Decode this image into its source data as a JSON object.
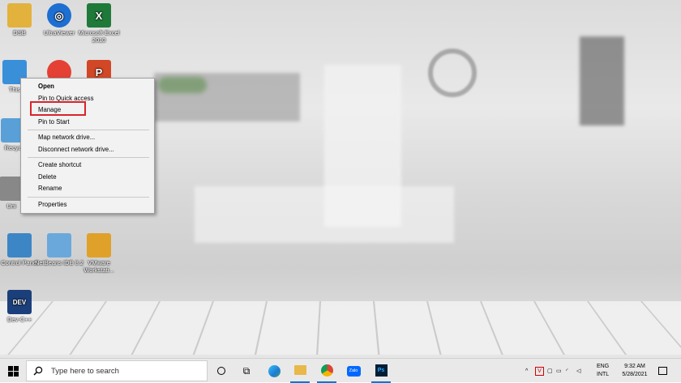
{
  "desktop": {
    "icons": [
      {
        "id": "dsb",
        "label": "DSB",
        "color": "#e3b23c"
      },
      {
        "id": "ultraviewer",
        "label": "UltraViewer",
        "color": "#1d6fd1"
      },
      {
        "id": "excel",
        "label": "Microsoft Excel 2010",
        "color": "#1f7a3a"
      },
      {
        "id": "this-pc",
        "label": "This",
        "color": "#3a8fd9"
      },
      {
        "id": "chrome",
        "label": "",
        "color": "#e44134"
      },
      {
        "id": "powerpoint",
        "label": "",
        "color": "#d24726"
      },
      {
        "id": "recycle",
        "label": "Recyc",
        "color": "#5aa0d8"
      },
      {
        "id": "uni",
        "label": "Uni",
        "color": "#888888"
      },
      {
        "id": "control-panel",
        "label": "Control Panel",
        "color": "#3d86c6"
      },
      {
        "id": "netbeans",
        "label": "NetBeans IDE 8.2",
        "color": "#6aa8dc"
      },
      {
        "id": "vmware",
        "label": "VMware Workstati...",
        "color": "#e0a12a"
      },
      {
        "id": "devcpp",
        "label": "Dev-C++",
        "color": "#1b3f7a"
      }
    ]
  },
  "context_menu": {
    "items": [
      {
        "label": "Open",
        "bold": true
      },
      {
        "label": "Pin to Quick access"
      },
      {
        "label": "Manage"
      },
      {
        "label": "Pin to Start"
      },
      {
        "sep": true
      },
      {
        "label": "Map network drive..."
      },
      {
        "label": "Disconnect network drive..."
      },
      {
        "sep": true
      },
      {
        "label": "Create shortcut"
      },
      {
        "label": "Delete"
      },
      {
        "label": "Rename"
      },
      {
        "sep": true
      },
      {
        "label": "Properties"
      }
    ]
  },
  "taskbar": {
    "search_placeholder": "Type here to search",
    "apps": [
      {
        "name": "task-view"
      },
      {
        "name": "edge"
      },
      {
        "name": "file-explorer"
      },
      {
        "name": "chrome"
      },
      {
        "name": "zalo",
        "label": "Zalo"
      },
      {
        "name": "photoshop",
        "label": "Ps"
      }
    ],
    "tray": {
      "lang": "ENG",
      "layout": "INTL",
      "time": "9:32 AM",
      "date": "5/28/2021"
    }
  }
}
